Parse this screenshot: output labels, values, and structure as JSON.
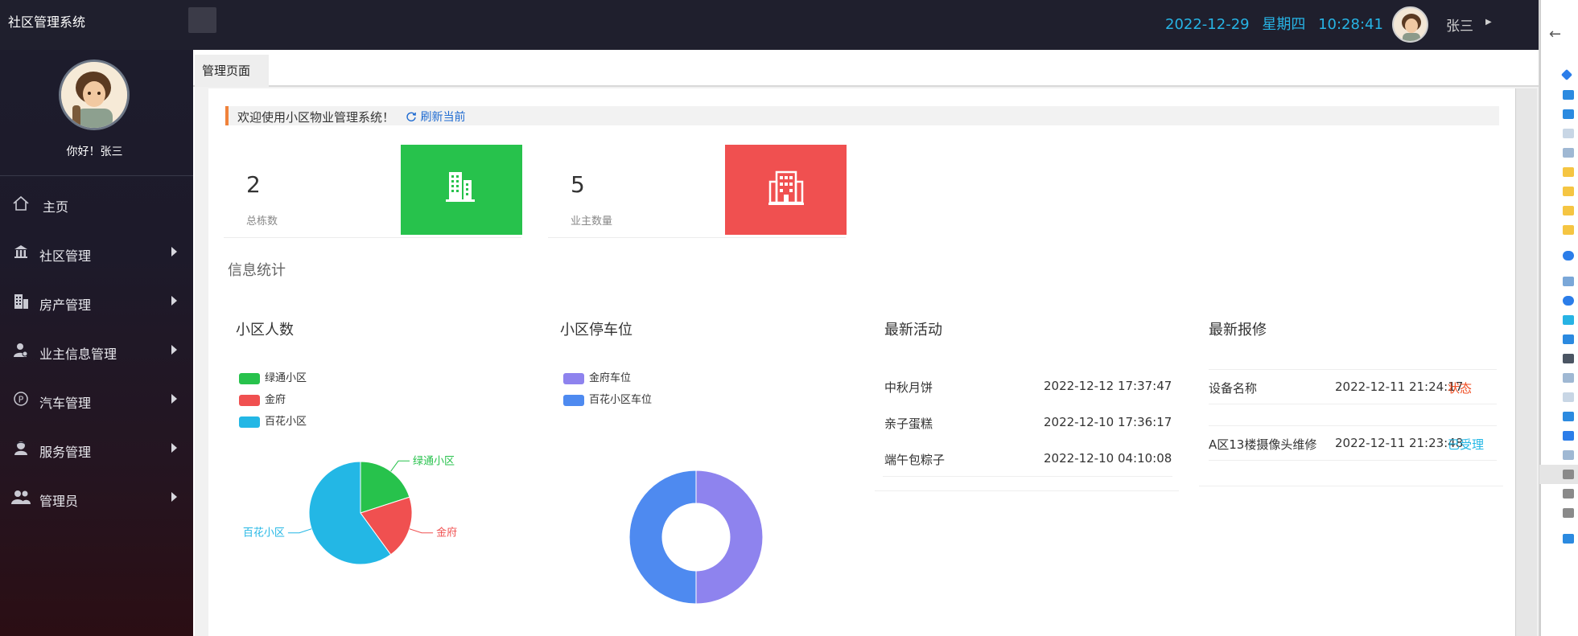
{
  "app": {
    "title": "社区管理系统"
  },
  "header": {
    "date": "2022-12-29",
    "weekday": "星期四",
    "time": "10:28:41",
    "username": "张三"
  },
  "sidebar": {
    "greeting": "你好！张三",
    "items": [
      {
        "label": "主页",
        "icon": "home-icon",
        "has_arrow": false
      },
      {
        "label": "社区管理",
        "icon": "bank-icon",
        "has_arrow": true
      },
      {
        "label": "房产管理",
        "icon": "building-icon",
        "has_arrow": true
      },
      {
        "label": "业主信息管理",
        "icon": "user-icon",
        "has_arrow": true
      },
      {
        "label": "汽车管理",
        "icon": "parking-icon",
        "has_arrow": true
      },
      {
        "label": "服务管理",
        "icon": "service-icon",
        "has_arrow": true
      },
      {
        "label": "管理员",
        "icon": "admin-users-icon",
        "has_arrow": true
      }
    ]
  },
  "tabs": [
    {
      "label": "管理页面"
    }
  ],
  "welcome": {
    "text": "欢迎使用小区物业管理系统！",
    "refresh": "刷新当前"
  },
  "stats": [
    {
      "value": "2",
      "label": "总栋数",
      "color": "#27c24c",
      "icon": "building-icon"
    },
    {
      "value": "5",
      "label": "业主数量",
      "color": "#f05050",
      "icon": "apartment-icon"
    }
  ],
  "section_title": "信息统计",
  "panels": {
    "residents": {
      "title": "小区人数",
      "legend": [
        {
          "name": "绿通小区",
          "color": "#27c24c"
        },
        {
          "name": "金府",
          "color": "#f05050"
        },
        {
          "name": "百花小区",
          "color": "#23b7e5"
        }
      ],
      "chart_data": {
        "type": "pie",
        "categories": [
          "绿通小区",
          "金府",
          "百花小区"
        ],
        "values": [
          2,
          2,
          6
        ],
        "colors": [
          "#27c24c",
          "#f05050",
          "#23b7e5"
        ]
      }
    },
    "parking": {
      "title": "小区停车位",
      "legend": [
        {
          "name": "金府车位",
          "color": "#8e83ee"
        },
        {
          "name": "百花小区车位",
          "color": "#4e8af0"
        }
      ],
      "chart_data": {
        "type": "pie",
        "categories": [
          "金府车位",
          "百花小区车位"
        ],
        "values": [
          1,
          1
        ],
        "colors": [
          "#8e83ee",
          "#4e8af0"
        ]
      }
    },
    "activities": {
      "title": "最新活动",
      "rows": [
        {
          "name": "中秋月饼",
          "time": "2022-12-12 17:37:47"
        },
        {
          "name": "亲子蛋糕",
          "time": "2022-12-10 17:36:17"
        },
        {
          "name": "端午包粽子",
          "time": "2022-12-10 04:10:08"
        }
      ]
    },
    "repairs": {
      "title": "最新报修",
      "rows": [
        {
          "name": "设备名称",
          "time": "2022-12-11 21:24:17",
          "status": "状态",
          "status_color": "#f04e23"
        },
        {
          "name": "A区13楼摄像头维修",
          "time": "2022-12-11 21:23:48",
          "status": "已受理",
          "status_color": "#23b7e5"
        }
      ]
    }
  }
}
